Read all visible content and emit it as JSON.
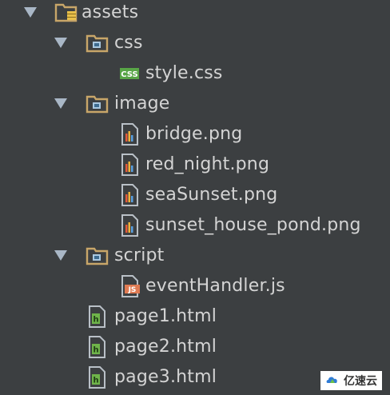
{
  "tree": {
    "assets": {
      "label": "assets",
      "icon": "resource-folder-icon",
      "expanded": true
    },
    "css": {
      "label": "css",
      "icon": "package-folder-icon",
      "expanded": true
    },
    "style_css": {
      "label": "style.css",
      "icon": "css-file-icon"
    },
    "image": {
      "label": "image",
      "icon": "package-folder-icon",
      "expanded": true
    },
    "bridge": {
      "label": "bridge.png",
      "icon": "image-file-icon"
    },
    "red_night": {
      "label": "red_night.png",
      "icon": "image-file-icon"
    },
    "seaSunset": {
      "label": "seaSunset.png",
      "icon": "image-file-icon"
    },
    "sunset_house_pond": {
      "label": "sunset_house_pond.png",
      "icon": "image-file-icon"
    },
    "script": {
      "label": "script",
      "icon": "package-folder-icon",
      "expanded": true
    },
    "eventHandler": {
      "label": "eventHandler.js",
      "icon": "js-file-icon"
    },
    "page1": {
      "label": "page1.html",
      "icon": "html-file-icon"
    },
    "page2": {
      "label": "page2.html",
      "icon": "html-file-icon"
    },
    "page3": {
      "label": "page3.html",
      "icon": "html-file-icon"
    }
  },
  "colors": {
    "background": "#3c3f41",
    "text": "#d4d4d4",
    "arrow": "#a9b7c6",
    "folder": "#c8a669",
    "css_badge": "#58a546",
    "js_badge": "#e07b53",
    "html_badge": "#6fb44a"
  },
  "watermark": {
    "text": "亿速云",
    "icon": "cloud-logo-icon"
  }
}
